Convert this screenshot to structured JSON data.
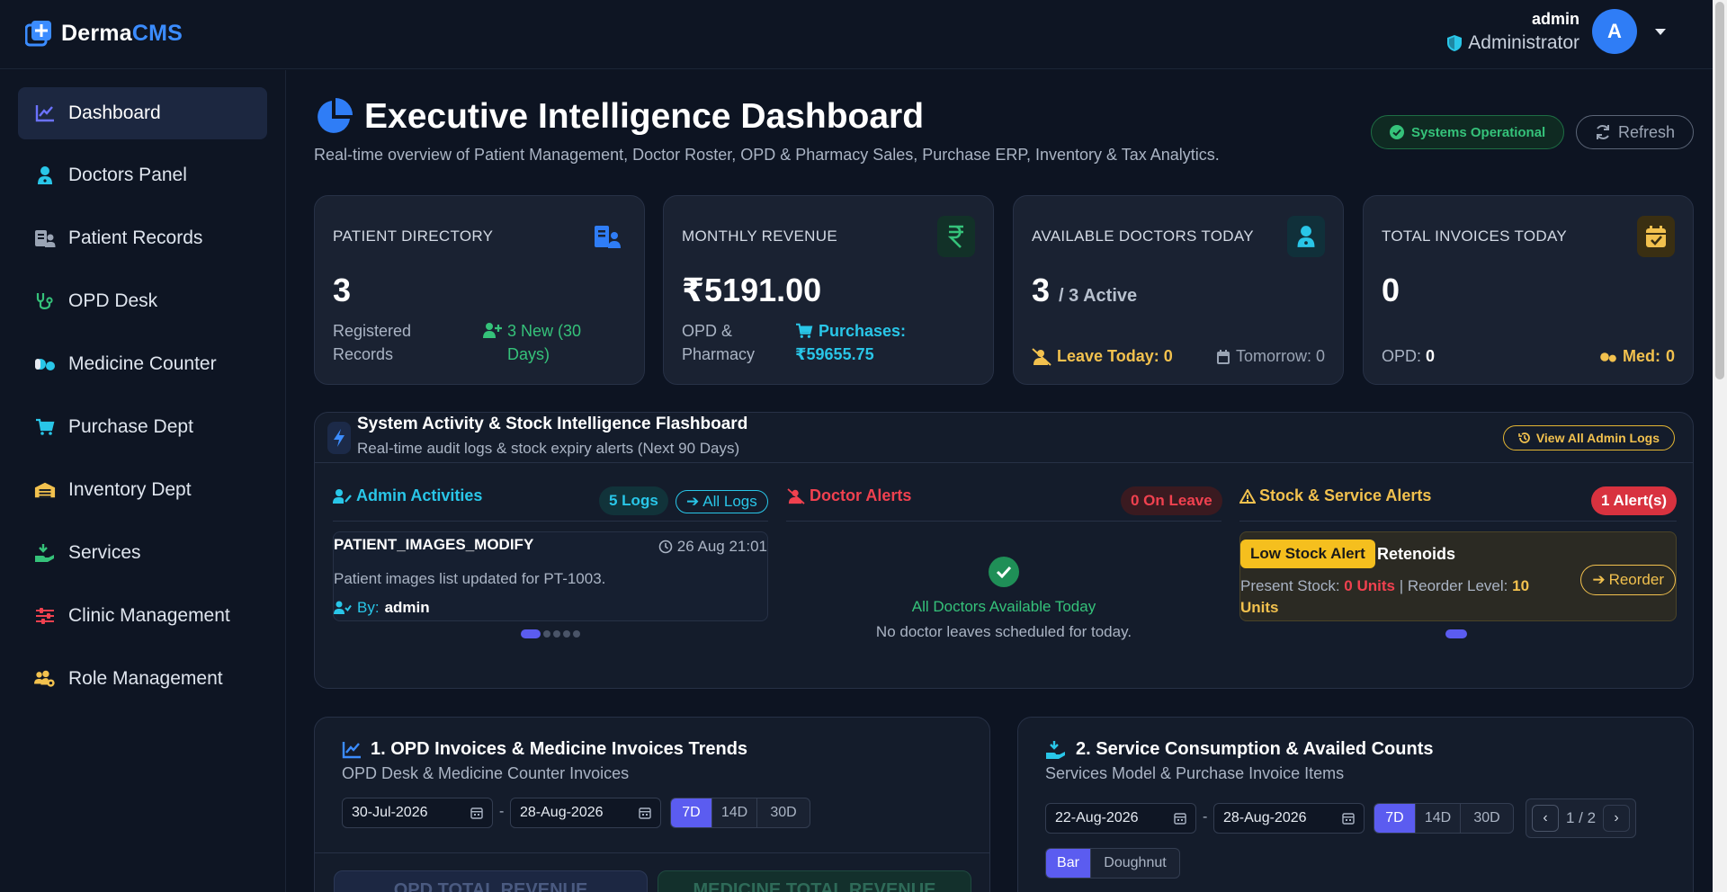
{
  "brand": {
    "name_prefix": "Derma",
    "name_accent": "CMS"
  },
  "user": {
    "name": "admin",
    "role": "Administrator",
    "avatar_letter": "A"
  },
  "sidebar": {
    "items": [
      {
        "label": "Dashboard",
        "icon": "chart-line-icon",
        "active": true
      },
      {
        "label": "Doctors Panel",
        "icon": "doctor-icon"
      },
      {
        "label": "Patient Records",
        "icon": "patient-records-icon"
      },
      {
        "label": "OPD Desk",
        "icon": "stethoscope-icon"
      },
      {
        "label": "Medicine Counter",
        "icon": "pills-icon"
      },
      {
        "label": "Purchase Dept",
        "icon": "cart-icon"
      },
      {
        "label": "Inventory Dept",
        "icon": "warehouse-icon"
      },
      {
        "label": "Services",
        "icon": "hand-holding-icon"
      },
      {
        "label": "Clinic Management",
        "icon": "sliders-icon"
      },
      {
        "label": "Role Management",
        "icon": "users-cog-icon"
      }
    ]
  },
  "header": {
    "title": "Executive Intelligence Dashboard",
    "subtitle": "Real-time overview of Patient Management, Doctor Roster, OPD & Pharmacy Sales, Purchase ERP, Inventory & Tax Analytics.",
    "status": "Systems Operational",
    "refresh": "Refresh"
  },
  "cards": {
    "patients": {
      "title": "PATIENT DIRECTORY",
      "value": "3",
      "foot_left": "Registered Records",
      "foot_right": "3 New (30 Days)"
    },
    "revenue": {
      "title": "MONTHLY REVENUE",
      "value": "₹5191.00",
      "foot_left": "OPD & Pharmacy",
      "foot_right_label": "Purchases:",
      "foot_right_value": "₹59655.75"
    },
    "doctors": {
      "title": "AVAILABLE DOCTORS TODAY",
      "value": "3",
      "value_suffix": "/ 3 Active",
      "leave_today": "Leave Today: 0",
      "tomorrow": "Tomorrow: 0"
    },
    "invoices": {
      "title": "TOTAL INVOICES TODAY",
      "value": "0",
      "opd_label": "OPD:",
      "opd_value": "0",
      "med_label": "Med:",
      "med_value": "0"
    }
  },
  "flash": {
    "title": "System Activity & Stock Intelligence Flashboard",
    "subtitle": "Real-time audit logs & stock expiry alerts (Next 90 Days)",
    "view_all": "View All Admin Logs",
    "admin": {
      "title": "Admin Activities",
      "count": "5 Logs",
      "all_logs": "All Logs",
      "log": {
        "action": "PATIENT_IMAGES_MODIFY",
        "time": "26 Aug 21:01",
        "desc": "Patient images list updated for PT-1003.",
        "by_label": "By:",
        "by_value": "admin"
      }
    },
    "doctor": {
      "title": "Doctor Alerts",
      "count": "0 On Leave",
      "ok_title": "All Doctors Available Today",
      "ok_sub": "No doctor leaves scheduled for today."
    },
    "stock": {
      "title": "Stock & Service Alerts",
      "count": "1 Alert(s)",
      "tag": "Low Stock Alert",
      "item": "Retenoids",
      "present_label": "Present Stock:",
      "present_value": "0 Units",
      "reorder_label": "| Reorder Level:",
      "reorder_value": "10 Units",
      "reorder_btn": "Reorder"
    }
  },
  "panel1": {
    "title": "1. OPD Invoices & Medicine Invoices Trends",
    "subtitle": "OPD Desk & Medicine Counter Invoices",
    "date_from": "30-Jul-2026",
    "date_to": "28-Aug-2026",
    "ranges": [
      "7D",
      "14D",
      "30D"
    ],
    "mini_left": "OPD TOTAL REVENUE",
    "mini_right": "MEDICINE TOTAL REVENUE"
  },
  "panel2": {
    "title": "2. Service Consumption & Availed Counts",
    "subtitle": "Services Model & Purchase Invoice Items",
    "date_from": "22-Aug-2026",
    "date_to": "28-Aug-2026",
    "ranges": [
      "7D",
      "14D",
      "30D"
    ],
    "page": "1 / 2",
    "chart_types": [
      "Bar",
      "Doughnut"
    ]
  },
  "colors": {
    "accent": "#3b8cff",
    "success": "#35c27a",
    "danger": "#f0414f",
    "warning": "#f2c14e",
    "cyan": "#29c6e8",
    "purple": "#5b5cf0"
  }
}
